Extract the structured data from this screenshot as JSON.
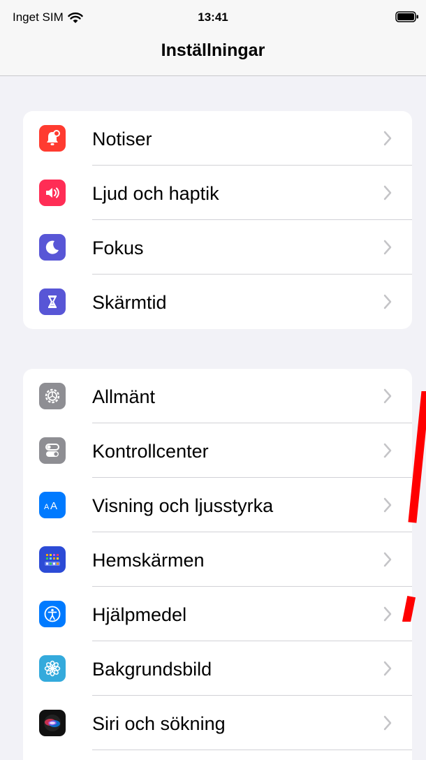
{
  "status_bar": {
    "carrier": "Inget SIM",
    "time": "13:41"
  },
  "nav": {
    "title": "Inställningar"
  },
  "group1": [
    {
      "label": "Notiser",
      "icon": "notifications-icon",
      "color": "#ff3b30"
    },
    {
      "label": "Ljud och haptik",
      "icon": "sound-icon",
      "color": "#ff2d55"
    },
    {
      "label": "Fokus",
      "icon": "moon-icon",
      "color": "#5856d6"
    },
    {
      "label": "Skärmtid",
      "icon": "hourglass-icon",
      "color": "#5856d6"
    }
  ],
  "group2": [
    {
      "label": "Allmänt",
      "icon": "gear-icon",
      "color": "#8e8e93"
    },
    {
      "label": "Kontrollcenter",
      "icon": "toggles-icon",
      "color": "#8e8e93"
    },
    {
      "label": "Visning och ljusstyrka",
      "icon": "text-size-icon",
      "color": "#007aff"
    },
    {
      "label": "Hemskärmen",
      "icon": "home-screen-icon",
      "color": "#2c4bd6"
    },
    {
      "label": "Hjälpmedel",
      "icon": "accessibility-icon",
      "color": "#007aff"
    },
    {
      "label": "Bakgrundsbild",
      "icon": "flower-icon",
      "color": "#34aadc"
    },
    {
      "label": "Siri och sökning",
      "icon": "siri-icon",
      "color": "#222222"
    }
  ]
}
